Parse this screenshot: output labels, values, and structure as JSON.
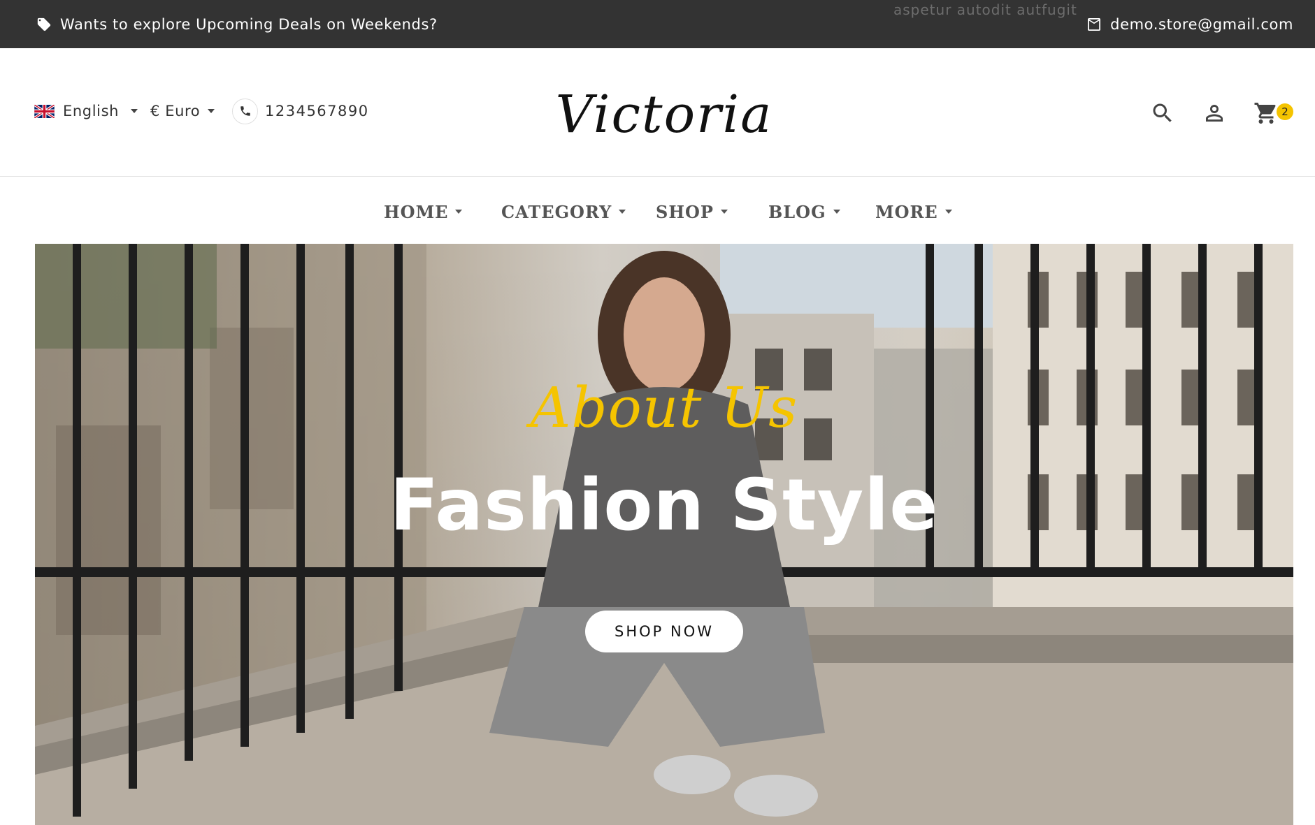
{
  "topbar": {
    "deal_text": "Wants to explore Upcoming Deals on Weekends?",
    "ghost_text": "aspetur autodit autfugit",
    "email": "demo.store@gmail.com"
  },
  "header": {
    "language": "English",
    "currency": "€ Euro",
    "phone": "1234567890",
    "logo_text": "Victoria",
    "cart_count": "2"
  },
  "nav": {
    "items": [
      {
        "label": "HOME"
      },
      {
        "label": "CATEGORY"
      },
      {
        "label": "SHOP"
      },
      {
        "label": "BLOG"
      },
      {
        "label": "MORE"
      }
    ]
  },
  "hero": {
    "subtitle": "About Us",
    "title": "Fashion Style",
    "button": "SHOP NOW"
  },
  "colors": {
    "topbar_bg": "#333333",
    "accent_yellow": "#f5c400",
    "nav_text": "#555555"
  },
  "icons": [
    "tag-icon",
    "mail-icon",
    "uk-flag-icon",
    "phone-icon",
    "search-icon",
    "user-icon",
    "cart-icon"
  ]
}
